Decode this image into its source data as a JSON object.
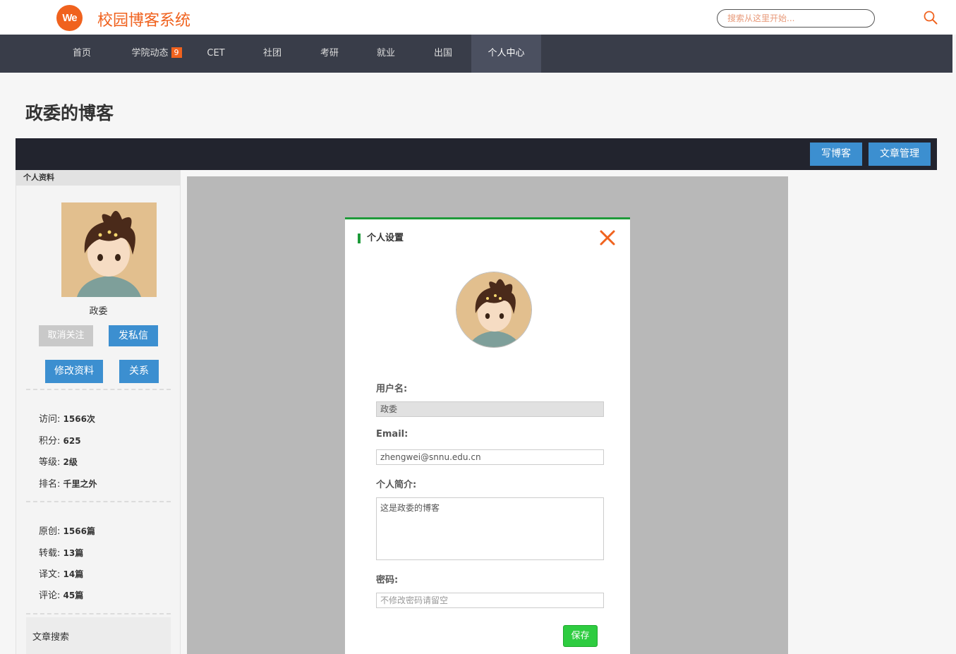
{
  "header": {
    "logo_text": "We",
    "site_title": "校园博客系统",
    "search_placeholder": "搜索从这里开始..."
  },
  "nav": {
    "items": [
      {
        "label": "首页"
      },
      {
        "label": "学院动态",
        "badge": "9"
      },
      {
        "label": "CET"
      },
      {
        "label": "社团"
      },
      {
        "label": "考研"
      },
      {
        "label": "就业"
      },
      {
        "label": "出国"
      },
      {
        "label": "个人中心",
        "active": true
      }
    ]
  },
  "page": {
    "title": "政委的博客",
    "toolbar": {
      "write_label": "写博客",
      "manage_label": "文章管理"
    }
  },
  "sidebar": {
    "header": "个人资料",
    "username": "政委",
    "unfollow_label": "取消关注",
    "message_label": "发私信",
    "edit_label": "修改资料",
    "relation_label": "关系",
    "stats": [
      {
        "label": "访问:",
        "value": "1566次"
      },
      {
        "label": "积分:",
        "value": "625"
      },
      {
        "label": "等级:",
        "value": "2级"
      },
      {
        "label": "排名:",
        "value": "千里之外"
      }
    ],
    "posts": [
      {
        "label": "原创:",
        "value": "1566篇"
      },
      {
        "label": "转载:",
        "value": "13篇"
      },
      {
        "label": "译文:",
        "value": "14篇"
      },
      {
        "label": "评论:",
        "value": "45篇"
      }
    ],
    "search_title": "文章搜索"
  },
  "modal": {
    "title": "个人设置",
    "username_label": "用户名:",
    "username_value": "政委",
    "email_label": "Email:",
    "email_value": "zhengwei@snnu.edu.cn",
    "bio_label": "个人简介:",
    "bio_value": "这是政委的博客",
    "password_label": "密码:",
    "password_placeholder": "不修改密码请留空",
    "save_label": "保存"
  },
  "colors": {
    "brand": "#f0621e",
    "nav_bg": "#393d49",
    "button_blue": "#3c8fd0",
    "modal_accent": "#1e9a3a",
    "save_green": "#2ecc40"
  },
  "icons": {
    "search": "search-icon",
    "close": "close-icon"
  }
}
